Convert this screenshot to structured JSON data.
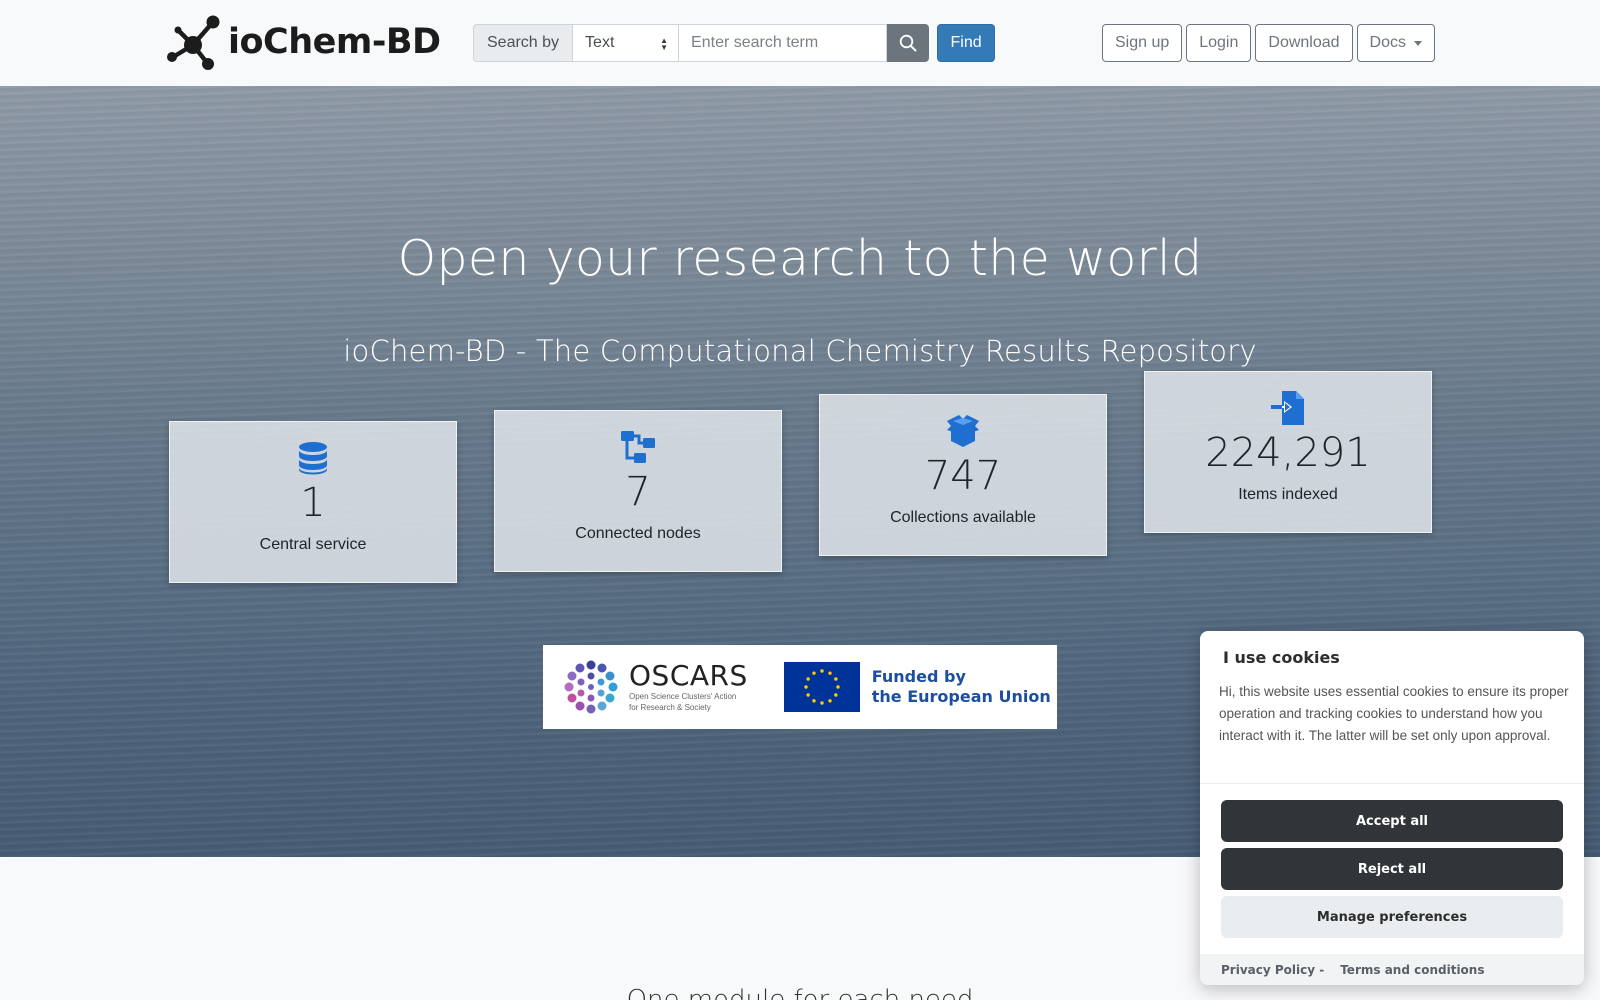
{
  "brand": {
    "name": "ioChem-BD"
  },
  "search": {
    "label": "Search by",
    "selected": "Text",
    "placeholder": "Enter search term",
    "find_label": "Find"
  },
  "nav": {
    "signup": "Sign up",
    "login": "Login",
    "download": "Download",
    "docs": "Docs"
  },
  "hero": {
    "title": "Open your research to the world",
    "subtitle": "ioChem-BD - The Computational Chemistry Results Repository"
  },
  "stats": [
    {
      "value": "1",
      "label": "Central service",
      "icon": "database-icon"
    },
    {
      "value": "7",
      "label": "Connected nodes",
      "icon": "network-icon"
    },
    {
      "value": "747",
      "label": "Collections available",
      "icon": "box-icon"
    },
    {
      "value": "224,291",
      "label": "Items indexed",
      "icon": "file-import-icon"
    }
  ],
  "sponsors": {
    "oscars_name": "OSCARS",
    "oscars_tagline_1": "Open Science Clusters' Action",
    "oscars_tagline_2": "for Research & Society",
    "eu_line1": "Funded by",
    "eu_line2": "the European Union"
  },
  "section": {
    "heading": "One module for each need"
  },
  "cookie": {
    "title": "I use cookies",
    "description": "Hi, this website uses essential cookies to ensure its proper operation and tracking cookies to understand how you interact with it. The latter will be set only upon approval.",
    "accept": "Accept all",
    "reject": "Reject all",
    "manage": "Manage preferences",
    "privacy": "Privacy Policy -",
    "terms": "Terms and conditions"
  },
  "colors": {
    "accent": "#337ab7",
    "icon_blue": "#1f6fd1",
    "dark_button": "#31353a"
  }
}
